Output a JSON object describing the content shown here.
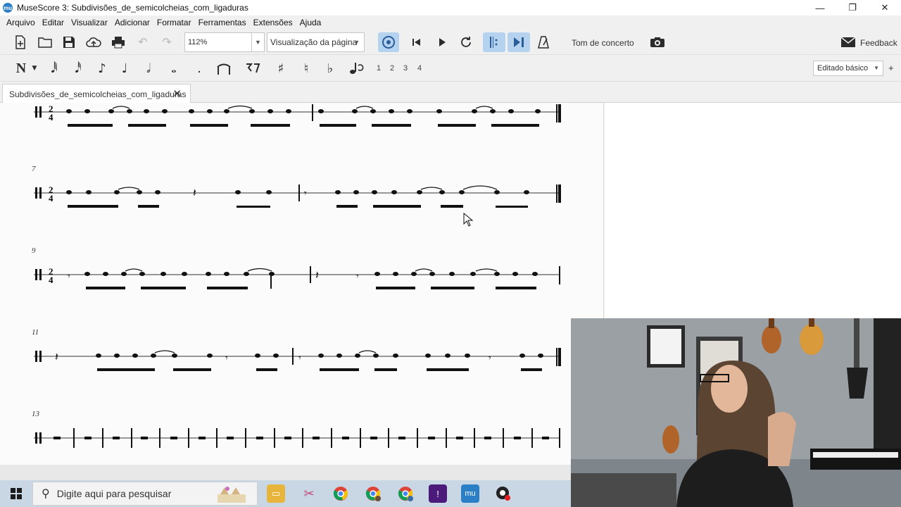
{
  "window": {
    "title": "MuseScore 3: Subdivisões_de_semicolcheias_com_ligaduras",
    "app_logo_text": "mu",
    "controls": [
      "—",
      "❐",
      "✕"
    ]
  },
  "menu": [
    "Arquivo",
    "Editar",
    "Visualizar",
    "Adicionar",
    "Formatar",
    "Ferramentas",
    "Extensões",
    "Ajuda"
  ],
  "toolbar": {
    "zoom_value": "112%",
    "view_mode": "Visualização da página",
    "concert_pitch_label": "Tom de concerto",
    "feedback_label": "Feedback"
  },
  "note_input": {
    "voices": [
      "1",
      "2",
      "3",
      "4"
    ],
    "workspace": "Editado básico",
    "add_workspace": "+"
  },
  "tab": {
    "label": "Subdivisões_de_semicolcheias_com_ligaduras",
    "close": "✕"
  },
  "score": {
    "measure_numbers": [
      "7",
      "9",
      "11",
      "13"
    ],
    "time_signature": {
      "numerator": "2",
      "denominator": "4"
    }
  },
  "taskbar": {
    "search_placeholder": "Digite aqui para pesquisar"
  },
  "colors": {
    "active_toolbar": "#b5d3ef",
    "taskbar": "#c9d6e4",
    "musescore_blue": "#2a7fc7"
  }
}
